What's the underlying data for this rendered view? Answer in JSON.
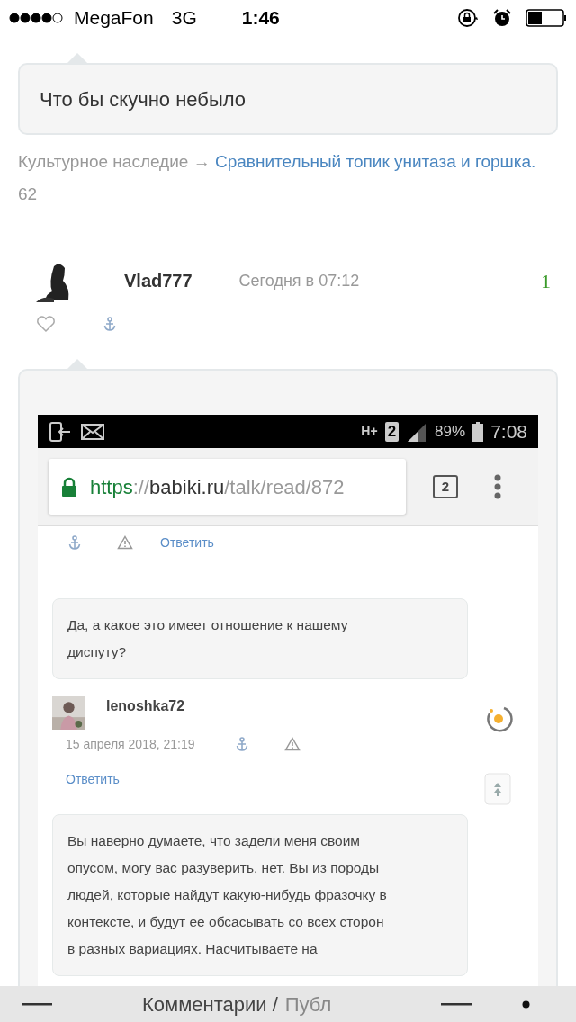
{
  "status_bar": {
    "carrier": "MegaFon",
    "network": "3G",
    "time": "1:46"
  },
  "post": {
    "text": "Что бы скучно небыло"
  },
  "breadcrumb": {
    "section": "Культурное наследие",
    "arrow": "→",
    "topic": "Сравнительный топик унитаза и горшка.",
    "count": "62"
  },
  "comment": {
    "author": "Vlad777",
    "date": "Сегодня в 07:12",
    "rating": "1"
  },
  "screenshot": {
    "status": {
      "network": "H+",
      "sim": "2",
      "battery": "89%",
      "time": "7:08"
    },
    "url": {
      "scheme": "https",
      "separator": "://",
      "host": "babiki.ru",
      "path": "/talk/read/872"
    },
    "tab_count": "2",
    "top_reply": "Ответить",
    "comments": [
      {
        "text": "Да, а какое это имеет отношение к нашему диспуту?",
        "author": "lenoshka72",
        "date": "15 апреля 2018, 21:19",
        "reply": "Ответить"
      },
      {
        "text": "Вы наверно думаете, что задели меня своим опусом, могу вас разуверить, нет. Вы из породы людей, которые найдут какую-нибудь фразочку в контексте, и будут ее обсасывать со всех сторон в разных вариациях. Насчитываете на"
      }
    ]
  },
  "bottom_bar": {
    "title": "Комментарии /",
    "title_cut": "Публ"
  }
}
